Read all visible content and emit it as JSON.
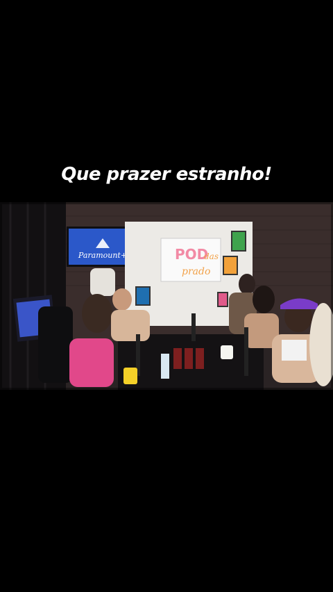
{
  "caption": {
    "text": "Que prazer estranho!"
  },
  "video": {
    "tv_screen_brand": "Paramount+",
    "backdrop_logo_line1": "POD",
    "backdrop_logo_line2": "das",
    "backdrop_logo_line3": "prado"
  }
}
